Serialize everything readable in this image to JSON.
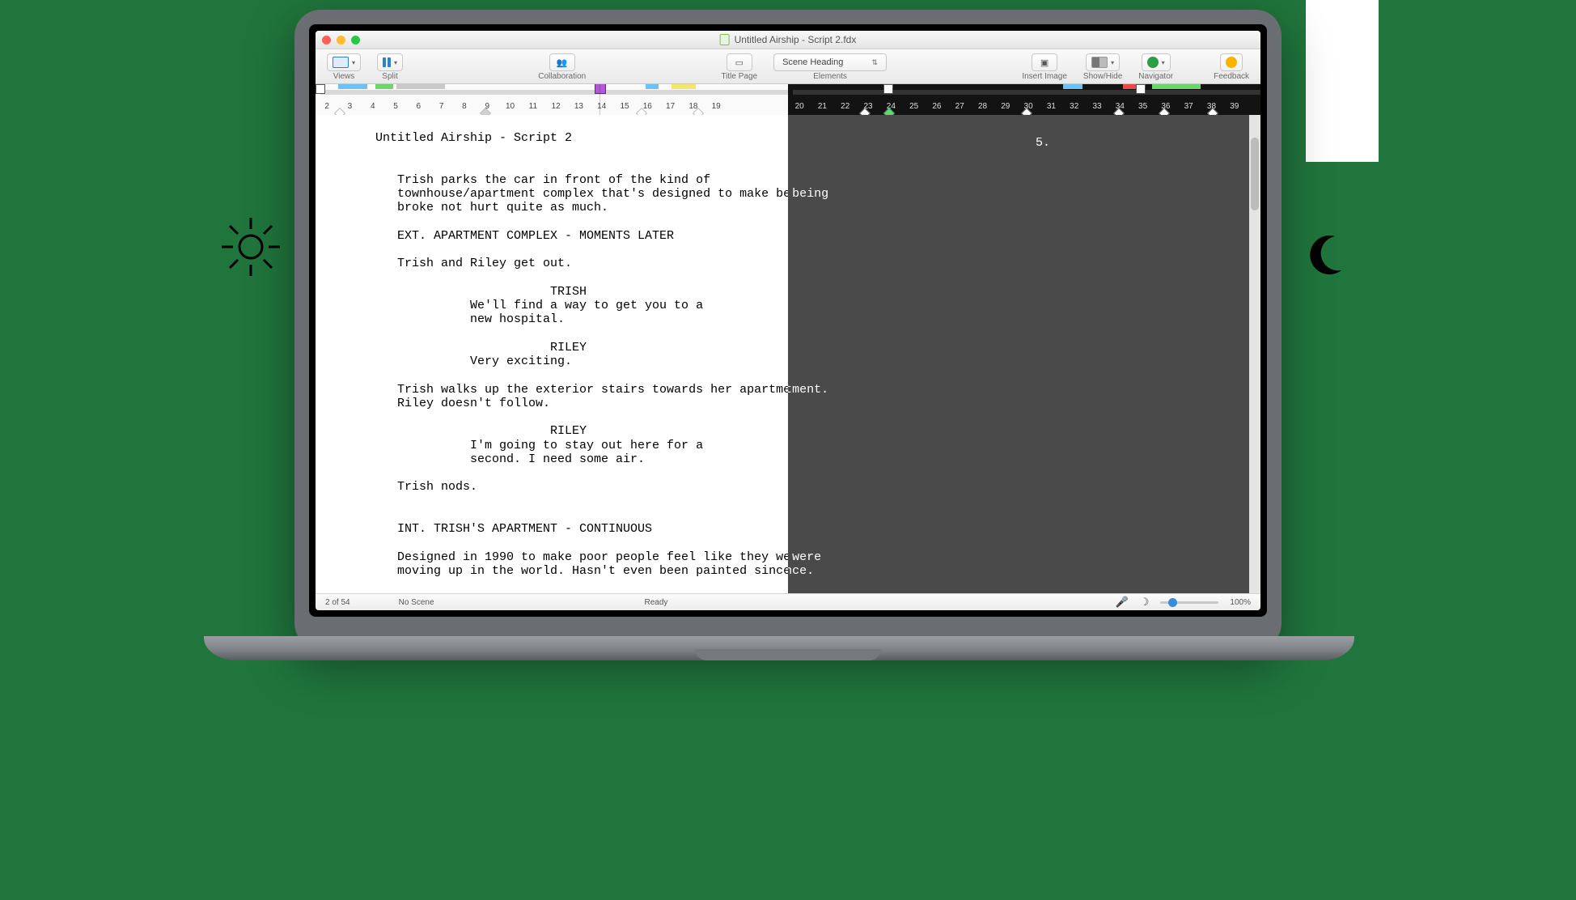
{
  "window": {
    "title": "Untitled Airship - Script 2.fdx"
  },
  "toolbar": {
    "views": "Views",
    "split": "Split",
    "collaboration": "Collaboration",
    "title_page": "Title Page",
    "elements": "Elements",
    "element_selected": "Scene Heading",
    "insert_image": "Insert Image",
    "show_hide": "Show/Hide",
    "navigator": "Navigator",
    "feedback": "Feedback"
  },
  "beatboard": {
    "left_numbers": [
      "2",
      "3",
      "4",
      "5",
      "6",
      "7",
      "8",
      "9",
      "10",
      "11",
      "12",
      "13",
      "14",
      "15",
      "16",
      "17",
      "18",
      "19"
    ],
    "right_numbers": [
      "20",
      "21",
      "22",
      "23",
      "24",
      "25",
      "26",
      "27",
      "28",
      "29",
      "30",
      "31",
      "32",
      "33",
      "34",
      "35",
      "36",
      "37",
      "38",
      "39"
    ]
  },
  "script": {
    "header": "Untitled Airship - Script 2",
    "page_number": "5.",
    "action1": "Trish parks the car in front of the kind of\ntownhouse/apartment complex that's designed to make being\nbroke not hurt quite as much.",
    "scene1": "EXT. APARTMENT COMPLEX - MOMENTS LATER",
    "action2": "Trish and Riley get out.",
    "char1": "TRISH",
    "dialog1": "We'll find a way to get you to a\nnew hospital.",
    "char2": "RILEY",
    "dialog2": "Very exciting.",
    "action3": "Trish walks up the exterior stairs towards her apartment.\nRiley doesn't follow.",
    "char3": "RILEY",
    "dialog3": "I'm going to stay out here for a\nsecond. I need some air.",
    "action4": "Trish nods.",
    "scene2": "INT. TRISH'S APARTMENT - CONTINUOUS",
    "action5": "Designed in 1990 to make poor people feel like they were\nmoving up in the world. Hasn't even been painted since."
  },
  "status": {
    "page": "2 of 54",
    "scene": "No Scene",
    "state": "Ready",
    "zoom": "100%"
  }
}
